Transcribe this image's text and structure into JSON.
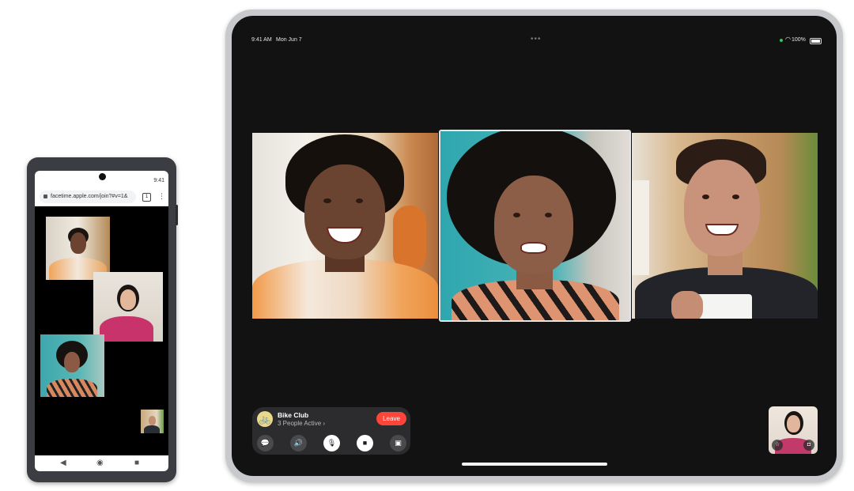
{
  "phone": {
    "status_time": "9:41",
    "url": "facetime.apple.com/join?#v=1&",
    "tab_count": "1",
    "menu_icon": "more-vert-icon",
    "nav_buttons": [
      "back-icon",
      "home-icon",
      "recents-icon"
    ]
  },
  "tablet": {
    "status_time": "9:41 AM",
    "status_date": "Mon Jun 7",
    "battery": "100%",
    "facetime": {
      "group_name": "Bike Club",
      "people_active": "3 People Active",
      "leave_label": "Leave",
      "controls": [
        {
          "name": "messages-icon",
          "glyph": "💬"
        },
        {
          "name": "speaker-icon",
          "glyph": "🔊"
        },
        {
          "name": "microphone-icon",
          "glyph": "🎙"
        },
        {
          "name": "video-camera-icon",
          "glyph": "■"
        },
        {
          "name": "shareplay-icon",
          "glyph": "▣"
        }
      ]
    }
  },
  "colors": {
    "leave": "#ff453a",
    "tablet_screen": "#121212",
    "phone_body": "#3b3d42",
    "panel": "#2c2c2e"
  }
}
